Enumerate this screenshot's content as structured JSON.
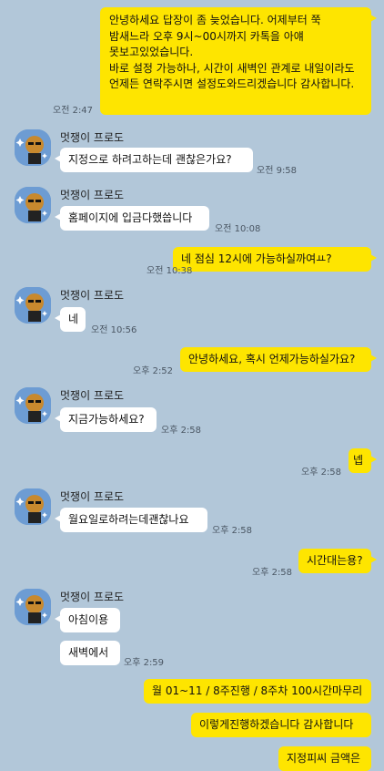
{
  "sender_name": "멋쟁이 프로도",
  "messages": {
    "m1": {
      "text": "안녕하세요 답장이 좀 늦었습니다. 어제부터 쭉 밤새느라 오후 9시~00시까지 카톡을 아얘 못보고있었습니다.\n바로 설정 가능하나, 시간이 새벽인 관계로 내일이라도 언제든 연락주시면 설정도와드리겠습니다 감사합니다.",
      "time": "오전 2:47"
    },
    "m2": {
      "text": "지정으로 하려고하는데 괜찮은가요?",
      "time": "오전 9:58"
    },
    "m3": {
      "text": "홈페이지에 입금다했씁니다",
      "time": "오전 10:08"
    },
    "m4": {
      "text": "네 점심 12시에 가능하실까여ㅛ?",
      "time": "오전 10:38"
    },
    "m5": {
      "text": "네",
      "time": "오전 10:56"
    },
    "m6": {
      "text": "안녕하세요, 혹시 언제가능하실가요?",
      "time": "오후 2:52"
    },
    "m7": {
      "text": "지금가능하세요?",
      "time": "오후 2:58"
    },
    "m8": {
      "text": "넵",
      "time": "오후 2:58"
    },
    "m9": {
      "text": "월요일로하려는데괜찮나요",
      "time": "오후 2:58"
    },
    "m10": {
      "text": "시간대는용?",
      "time": "오후 2:58"
    },
    "m11": {
      "text": "아침이용",
      "time": ""
    },
    "m12": {
      "text": "새벽에서",
      "time": "오후 2:59"
    },
    "m13": {
      "text": "월 01~11 / 8주진행 / 8주차 100시간마무리",
      "time": ""
    },
    "m14": {
      "text": "이렇게진행하겠습니다 감사합니다",
      "time": ""
    },
    "m15": {
      "text": "지정피씨 금액은",
      "time": ""
    }
  },
  "colors": {
    "background": "#b2c7d9",
    "my_bubble": "#fee500",
    "their_bubble": "#ffffff"
  },
  "icons": {
    "avatar": "frodo-character-avatar-icon"
  }
}
